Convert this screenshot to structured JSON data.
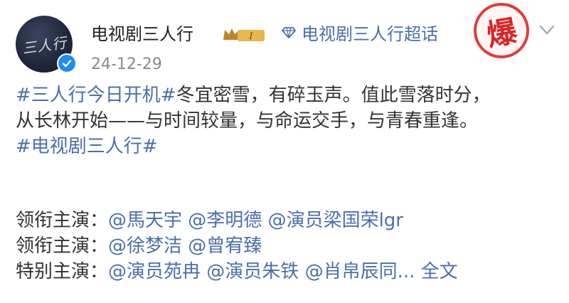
{
  "header": {
    "avatar_text": "三人行",
    "username": "电视剧三人行",
    "vip_level": "I",
    "topic_link": "电视剧三人行超话",
    "stamp_char": "爆",
    "date": "24-12-29"
  },
  "post": {
    "line1_hashtag": "#三人行今日开机#",
    "line1_text": "冬宜密雪，有碎玉声。值此雪落时分，",
    "line2_text": "从长林开始——与时间较量，与命运交手，与青春重逢。",
    "line3_hashtag": "#电视剧三人行#"
  },
  "cast": {
    "rows": [
      {
        "label": "领衔主演：",
        "mentions": [
          "@馬天宇",
          "@李明德",
          "@演员梁国荣lgr"
        ]
      },
      {
        "label": "领衔主演：",
        "mentions": [
          "@徐梦洁",
          "@曾宥臻"
        ]
      },
      {
        "label": "特别主演：",
        "mentions": [
          "@演员苑冉",
          "@演员朱铁",
          "@肖帛辰同..."
        ]
      }
    ],
    "more_label": "全文"
  },
  "colors": {
    "link": "#4a6fa8",
    "verified": "#1d8df2",
    "stamp": "#d92525"
  },
  "icons": [
    "verified-icon",
    "vip-crown-icon",
    "topic-diamond-icon",
    "chevron-down-icon"
  ]
}
